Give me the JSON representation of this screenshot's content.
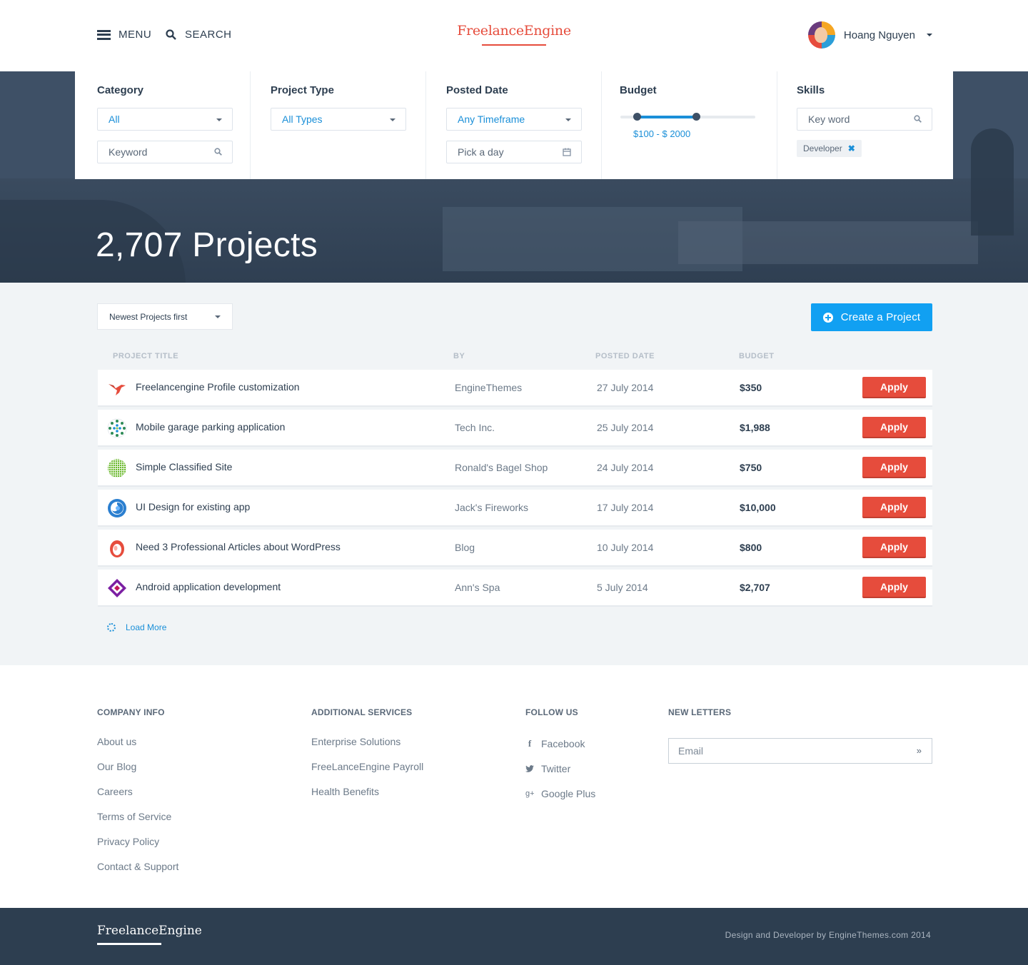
{
  "header": {
    "menu_label": "MENU",
    "search_label": "SEARCH",
    "logo": "FreelanceEngine",
    "user_name": "Hoang Nguyen"
  },
  "filters": {
    "category": {
      "label": "Category",
      "selected": "All",
      "keyword_placeholder": "Keyword"
    },
    "project_type": {
      "label": "Project Type",
      "selected": "All Types"
    },
    "posted_date": {
      "label": "Posted Date",
      "selected": "Any Timeframe",
      "date_placeholder": "Pick a day"
    },
    "budget": {
      "label": "Budget",
      "range_label": "$100 - $ 2000",
      "min_fraction": 0.12,
      "max_fraction": 0.56
    },
    "skills": {
      "label": "Skills",
      "keyword_placeholder": "Key word",
      "tags": [
        "Developer"
      ]
    }
  },
  "hero": {
    "title": "2,707 Projects"
  },
  "listing": {
    "sort_selected": "Newest Projects first",
    "create_button": "Create a Project",
    "columns": [
      "PROJECT TITLE",
      "BY",
      "POSTED DATE",
      "BUDGET"
    ],
    "apply_label": "Apply",
    "load_more": "Load More",
    "projects": [
      {
        "title": "Freelancengine Profile customization",
        "by": "EngineThemes",
        "date": "27 July 2014",
        "budget": "$350",
        "icon": "hummingbird-logo-icon"
      },
      {
        "title": "Mobile garage parking application",
        "by": "Tech Inc.",
        "date": "25 July 2014",
        "budget": "$1,988",
        "icon": "dotted-globe-logo-icon"
      },
      {
        "title": "Simple Classified Site",
        "by": "Ronald's Bagel Shop",
        "date": "24 July 2014",
        "budget": "$750",
        "icon": "green-grid-globe-logo-icon"
      },
      {
        "title": "UI Design for existing app",
        "by": "Jack's Fireworks",
        "date": "17 July 2014",
        "budget": "$10,000",
        "icon": "blue-swirl-logo-icon"
      },
      {
        "title": "Need 3 Professional Articles about WordPress",
        "by": "Blog",
        "date": "10 July 2014",
        "budget": "$800",
        "icon": "red-egg-logo-icon"
      },
      {
        "title": "Android application development",
        "by": "Ann's Spa",
        "date": "5 July 2014",
        "budget": "$2,707",
        "icon": "purple-diamond-logo-icon"
      }
    ]
  },
  "footer": {
    "company_info": {
      "heading": "COMPANY INFO",
      "links": [
        "About us",
        "Our Blog",
        "Careers",
        "Terms of Service",
        "Privacy Policy",
        "Contact & Support"
      ]
    },
    "additional_services": {
      "heading": "ADDITIONAL SERVICES",
      "links": [
        "Enterprise Solutions",
        "FreeLanceEngine Payroll",
        "Health Benefits"
      ]
    },
    "follow_us": {
      "heading": "FOLLOW US",
      "links": [
        "Facebook",
        "Twitter",
        "Google Plus"
      ]
    },
    "newsletter": {
      "heading": "NEW LETTERS",
      "email_placeholder": "Email"
    },
    "bottom_logo": "FreelanceEngine",
    "copyright": "Design and Developer by EngineThemes.com 2014"
  },
  "colors": {
    "accent_red": "#e64c3c",
    "accent_blue": "#11a0f2",
    "link_blue": "#1a8fd8",
    "navy": "#2d3e50"
  }
}
